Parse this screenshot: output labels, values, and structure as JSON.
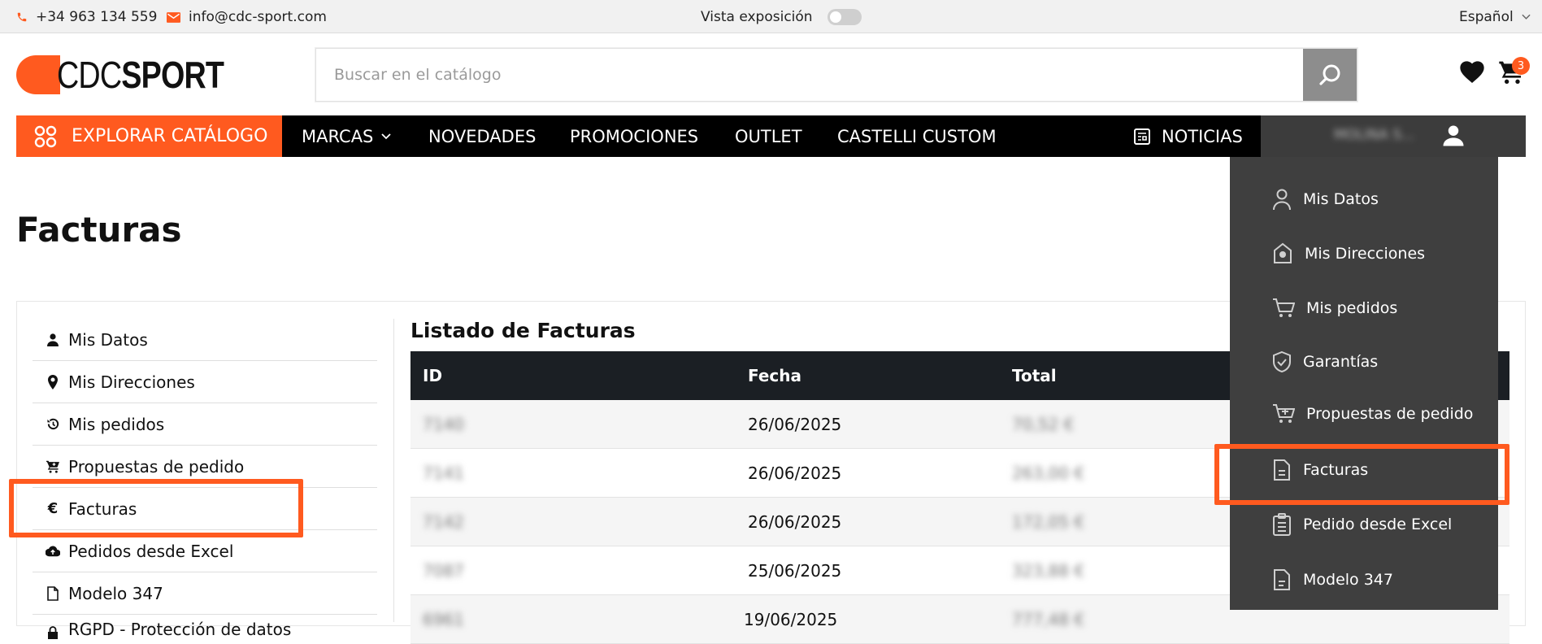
{
  "topbar": {
    "phone": "+34 963 134 559",
    "email": "info@cdc-sport.com",
    "exposition_label": "Vista exposición",
    "language": "Español"
  },
  "header": {
    "logo_part1": "CDC",
    "logo_part2": "SPORT",
    "search_placeholder": "Buscar en el catálogo",
    "cart_count": "3",
    "brand_color": "#ff5a1f"
  },
  "nav": {
    "explore": "EXPLORAR CATÁLOGO",
    "items": [
      "MARCAS",
      "NOVEDADES",
      "PROMOCIONES",
      "OUTLET",
      "CASTELLI CUSTOM"
    ],
    "news": "NOTICIAS",
    "account_name": "MOLINA S..."
  },
  "page": {
    "title": "Facturas"
  },
  "side_menu": [
    {
      "label": "Mis Datos",
      "icon": "user-icon"
    },
    {
      "label": "Mis Direcciones",
      "icon": "map-pin-icon"
    },
    {
      "label": "Mis pedidos",
      "icon": "history-icon"
    },
    {
      "label": "Propuestas de pedido",
      "icon": "cart-plus-icon"
    },
    {
      "label": "Facturas",
      "icon": "euro-icon"
    },
    {
      "label": "Pedidos desde Excel",
      "icon": "cloud-upload-icon"
    },
    {
      "label": "Modelo 347",
      "icon": "file-icon"
    },
    {
      "label": "RGPD - Protección de datos",
      "icon": "lock-icon"
    }
  ],
  "invoices": {
    "title": "Listado de Facturas",
    "columns": [
      "ID",
      "Fecha",
      "Total"
    ],
    "rows": [
      {
        "id": "7140",
        "date": "26/06/2025",
        "total": "70,52 €"
      },
      {
        "id": "7141",
        "date": "26/06/2025",
        "total": "263,00 €"
      },
      {
        "id": "7142",
        "date": "26/06/2025",
        "total": "172,05 €"
      },
      {
        "id": "7087",
        "date": "25/06/2025",
        "total": "323,88 €"
      },
      {
        "id": "6961",
        "date": "19/06/2025",
        "total": "777,48 €"
      }
    ]
  },
  "account_dropdown": [
    {
      "label": "Mis Datos",
      "icon": "user-icon"
    },
    {
      "label": "Mis Direcciones",
      "icon": "home-pin-icon"
    },
    {
      "label": "Mis pedidos",
      "icon": "cart-icon"
    },
    {
      "label": "Garantías",
      "icon": "shield-check-icon"
    },
    {
      "label": "Propuestas de pedido",
      "icon": "cart-plus-icon"
    },
    {
      "label": "Facturas",
      "icon": "invoice-icon"
    },
    {
      "label": "Pedido desde Excel",
      "icon": "clipboard-list-icon"
    },
    {
      "label": "Modelo 347",
      "icon": "document-icon"
    }
  ]
}
